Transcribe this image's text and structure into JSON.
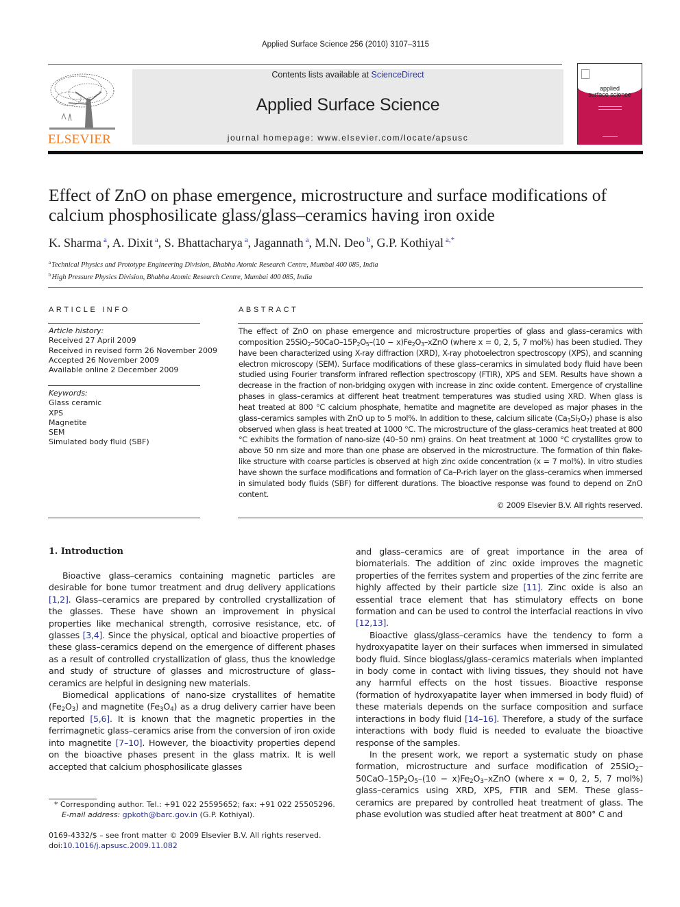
{
  "header": {
    "citation": "Applied Surface Science 256 (2010) 3107–3115",
    "contents_prefix": "Contents lists available at ",
    "contents_link": "ScienceDirect",
    "journal_title": "Applied Surface Science",
    "homepage_prefix": "journal homepage: ",
    "homepage_url": "www.elsevier.com/locate/apsusc",
    "publisher_logo_text": "ELSEVIER",
    "cover_title_line1": "applied",
    "cover_title_line2": "surface science",
    "colors": {
      "publisher_orange": "#f47b20",
      "cover_red": "#c41551",
      "link_blue": "#2a3390",
      "banner_gray": "#e9e9e9"
    }
  },
  "article": {
    "title": "Effect of ZnO on phase emergence, microstructure and surface modifications of calcium phosphosilicate glass/glass–ceramics having iron oxide",
    "authors": [
      {
        "name": "K. Sharma",
        "aff": "a"
      },
      {
        "name": "A. Dixit",
        "aff": "a"
      },
      {
        "name": "S. Bhattacharya",
        "aff": "a"
      },
      {
        "name": "Jagannath",
        "aff": "a"
      },
      {
        "name": "M.N. Deo",
        "aff": "b"
      },
      {
        "name": "G.P. Kothiyal",
        "aff": "a,*"
      }
    ],
    "affiliations": [
      {
        "key": "a",
        "text": "Technical Physics and Prototype Engineering Division, Bhabha Atomic Research Centre, Mumbai 400 085, India"
      },
      {
        "key": "b",
        "text": "High Pressure Physics Division, Bhabha Atomic Research Centre, Mumbai 400 085, India"
      }
    ]
  },
  "article_info": {
    "caption": "ARTICLE INFO",
    "history_label": "Article history:",
    "history": [
      "Received 27 April 2009",
      "Received in revised form 26 November 2009",
      "Accepted 26 November 2009",
      "Available online 2 December 2009"
    ],
    "keywords_label": "Keywords:",
    "keywords": [
      "Glass ceramic",
      "XPS",
      "Magnetite",
      "SEM",
      "Simulated body fluid (SBF)"
    ]
  },
  "abstract": {
    "caption": "ABSTRACT",
    "p1": "The effect of ZnO on phase emergence and microstructure properties of glass and glass–ceramics with composition 25SiO",
    "p2": "–50CaO–15P",
    "p3": "O",
    "p4": "–(10 − x)Fe",
    "p5": "O",
    "p6": "–xZnO (where x = 0, 2, 5, 7 mol%) has been studied. They have been characterized using X-ray diffraction (XRD), X-ray photoelectron spectroscopy (XPS), and scanning electron microscopy (SEM). Surface modifications of these glass–ceramics in simulated body fluid have been studied using Fourier transform infrared reflection spectroscopy (FTIR), XPS and SEM. Results have shown a decrease in the fraction of non-bridging oxygen with increase in zinc oxide content. Emergence of crystalline phases in glass–ceramics at different heat treatment temperatures was studied using XRD. When glass is heat treated at 800 °C calcium phosphate, hematite and magnetite are developed as major phases in the glass–ceramics samples with ZnO up to 5 mol%. In addition to these, calcium silicate (Ca",
    "p7": "Si",
    "p8": "O",
    "p9": ") phase is also observed when glass is heat treated at 1000 °C. The microstructure of the glass–ceramics heat treated at 800 °C exhibits the formation of nano-size (40–50 nm) grains. On heat treatment at 1000 °C crystallites grow to above 50 nm size and more than one phase are observed in the microstructure. The formation of thin flake-like structure with coarse particles is observed at high zinc oxide concentration (x = 7 mol%). In vitro studies have shown the surface modifications and formation of Ca–P-rich layer on the glass–ceramics when immersed in simulated body fluids (SBF) for different durations. The bioactive response was found to depend on ZnO content.",
    "copyright": "© 2009 Elsevier B.V. All rights reserved."
  },
  "body": {
    "section_heading": "1.  Introduction",
    "left": {
      "p1a": "Bioactive glass–ceramics containing magnetic particles are desirable for bone tumor treatment and drug delivery applications ",
      "ref1": "[1,2]",
      "p1b": ". Glass–ceramics are prepared by controlled crystallization of the glasses. These have shown an improvement in physical properties like mechanical strength, corrosive resistance, etc. of glasses ",
      "ref2": "[3,4]",
      "p1c": ". Since the physical, optical and bioactive properties of these glass–ceramics depend on the emergence of different phases as a result of controlled crystallization of glass, thus the knowledge and study of structure of glasses and microstructure of glass–ceramics are helpful in designing new materials.",
      "p2a": "Biomedical applications of nano-size crystallites of hematite (Fe",
      "p2b": "O",
      "p2c": ") and magnetite (Fe",
      "p2d": "O",
      "p2e": ") as a drug delivery carrier have been reported ",
      "ref3": "[5,6]",
      "p2f": ". It is known that the magnetic properties in the ferrimagnetic glass–ceramics arise from the conversion of iron oxide into magnetite ",
      "ref4": "[7–10]",
      "p2g": ". However, the bioactivity properties depend on the bioactive phases present in the glass matrix. It is well accepted that calcium phosphosilicate glasses"
    },
    "right": {
      "p1a": "and glass–ceramics are of great importance in the area of biomaterials. The addition of zinc oxide improves the magnetic properties of the ferrites system and properties of the zinc ferrite are highly affected by their particle size ",
      "ref1": "[11]",
      "p1b": ". Zinc oxide is also an essential trace element that has stimulatory effects on bone formation and can be used to control the interfacial reactions in vivo ",
      "ref2": "[12,13]",
      "p1c": ".",
      "p2a": "Bioactive glass/glass–ceramics have the tendency to form a hydroxyapatite layer on their surfaces when immersed in simulated body fluid. Since bioglass/glass–ceramics materials when implanted in body come in contact with living tissues, they should not have any harmful effects on the host tissues. Bioactive response (formation of hydroxyapatite layer when immersed in body fluid) of these materials depends on the surface composition and surface interactions in body fluid ",
      "ref3": "[14–16]",
      "p2b": ". Therefore, a study of the surface interactions with body fluid is needed to evaluate the bioactive response of the samples.",
      "p3a": "In the present work, we report a systematic study on phase formation, microstructure and surface modification of 25SiO",
      "p3b": "–50CaO–15P",
      "p3c": "O",
      "p3d": "–(10 − x)Fe",
      "p3e": "O",
      "p3f": "–xZnO (where x = 0, 2, 5, 7 mol%) glass–ceramics using XRD, XPS, FTIR and SEM. These glass–ceramics are prepared by controlled heat treatment of glass. The phase evolution was studied after heat treatment at 800° C and"
    }
  },
  "footnote": {
    "corresponding": "* Corresponding author. Tel.: +91 022 25595652; fax: +91 022 25505296.",
    "email_label": "E-mail address: ",
    "email": "gpkoth@barc.gov.in",
    "email_suffix": " (G.P. Kothiyal).",
    "issn": "0169-4332/$ – see front matter © 2009 Elsevier B.V. All rights reserved.",
    "doi_prefix": "doi:",
    "doi": "10.1016/j.apsusc.2009.11.082"
  }
}
